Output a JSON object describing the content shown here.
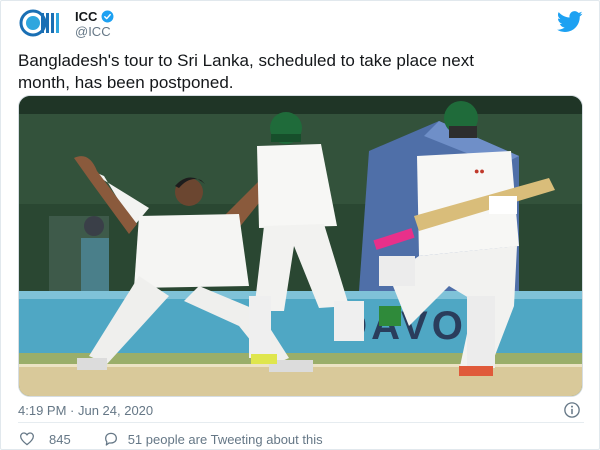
{
  "author": {
    "name": "ICC",
    "handle": "@ICC",
    "logo_icon": "icc-logo-icon",
    "verified_icon": "verified-badge-icon"
  },
  "platform_icon": "twitter-bird-icon",
  "tweet": {
    "text_line_1": "Bangladesh's tour to Sri Lanka, scheduled to take place next",
    "text_line_2": "month, has been postponed."
  },
  "photo": {
    "banner_text": "DAVOR"
  },
  "meta": {
    "timestamp": "4:19 PM · Jun 24, 2020"
  },
  "engagement": {
    "likes": "845",
    "conversation": "51 people are Tweeting about this"
  },
  "colors": {
    "twitter_blue": "#1da1f2",
    "secondary_text": "#657786",
    "stadium_green": "#2a4732",
    "pitch": "#d9c99a",
    "grass": "#9aae6a"
  }
}
